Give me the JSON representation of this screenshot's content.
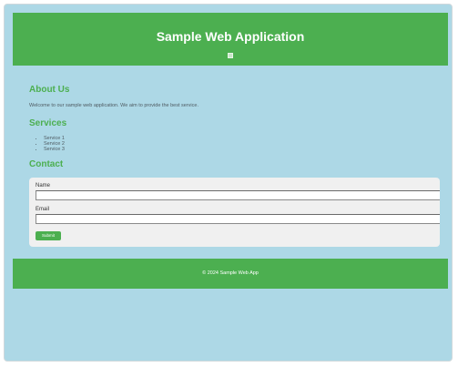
{
  "header": {
    "title": "Sample Web Application",
    "logo_icon": "broken-image-icon"
  },
  "about": {
    "heading": "About Us",
    "text": "Welcome to our sample web application. We aim to provide the best service."
  },
  "services": {
    "heading": "Services",
    "items": [
      "Service 1",
      "Service 2",
      "Service 3"
    ]
  },
  "contact": {
    "heading": "Contact",
    "name_label": "Name",
    "name_value": "",
    "email_label": "Email",
    "email_value": "",
    "submit_label": "Submit"
  },
  "footer": {
    "text": "© 2024 Sample Web App"
  },
  "colors": {
    "page_background": "#add8e6",
    "brand_green": "#4caf50",
    "form_background": "#f0f0f0"
  }
}
